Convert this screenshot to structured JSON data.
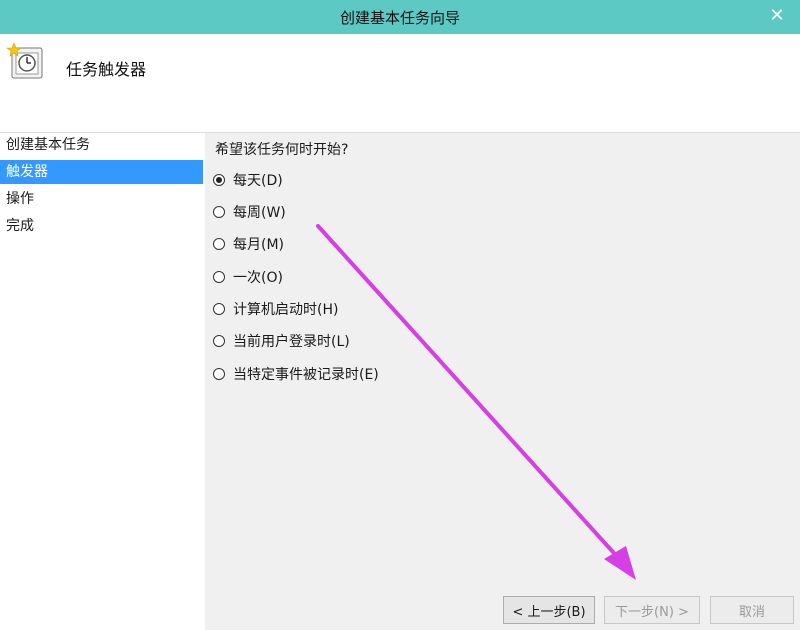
{
  "window": {
    "title": "创建基本任务向导"
  },
  "header": {
    "heading": "任务触发器"
  },
  "nav": {
    "items": [
      {
        "label": "创建基本任务",
        "active": false
      },
      {
        "label": "触发器",
        "active": true
      },
      {
        "label": "操作",
        "active": false
      },
      {
        "label": "完成",
        "active": false
      }
    ]
  },
  "main": {
    "question": "希望该任务何时开始?",
    "options": [
      {
        "label": "每天(D)",
        "checked": true
      },
      {
        "label": "每周(W)",
        "checked": false
      },
      {
        "label": "每月(M)",
        "checked": false
      },
      {
        "label": "一次(O)",
        "checked": false
      },
      {
        "label": "计算机启动时(H)",
        "checked": false
      },
      {
        "label": "当前用户登录时(L)",
        "checked": false
      },
      {
        "label": "当特定事件被记录时(E)",
        "checked": false
      }
    ]
  },
  "footer": {
    "back_label": "< 上一步(B)",
    "next_label": "下一步(N) >",
    "cancel_label": "取消"
  },
  "colors": {
    "titlebar": "#5cc9c4",
    "selection": "#3399ff",
    "annotation_arrow": "#d63ee6"
  }
}
